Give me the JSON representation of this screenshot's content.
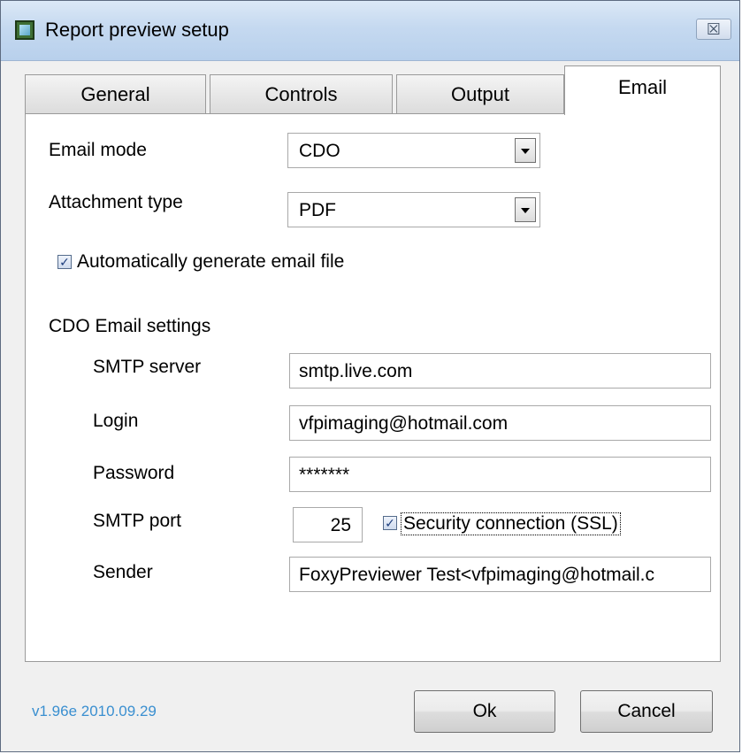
{
  "window": {
    "title": "Report preview setup",
    "close_glyph": "☒"
  },
  "tabs": [
    {
      "label": "General"
    },
    {
      "label": "Controls"
    },
    {
      "label": "Output"
    },
    {
      "label": "Email"
    }
  ],
  "email": {
    "mode_label": "Email mode",
    "mode_value": "CDO",
    "attachment_label": "Attachment type",
    "attachment_value": "PDF",
    "auto_generate_label": "Automatically generate email file",
    "auto_generate_checked": true,
    "cdo_section_label": "CDO Email settings",
    "smtp_server_label": "SMTP server",
    "smtp_server_value": "smtp.live.com",
    "login_label": "Login",
    "login_value": "vfpimaging@hotmail.com",
    "password_label": "Password",
    "password_value": "*******",
    "smtp_port_label": "SMTP port",
    "smtp_port_value": "25",
    "ssl_label": "Security connection (SSL)",
    "ssl_checked": true,
    "sender_label": "Sender",
    "sender_value": "FoxyPreviewer Test<vfpimaging@hotmail.c"
  },
  "footer": {
    "version": "v1.96e 2010.09.29",
    "ok_label": "Ok",
    "cancel_label": "Cancel"
  },
  "icons": {
    "app": "app-icon",
    "close": "close-icon",
    "dropdown": "chevron-down-icon",
    "check": "checkmark-icon"
  }
}
